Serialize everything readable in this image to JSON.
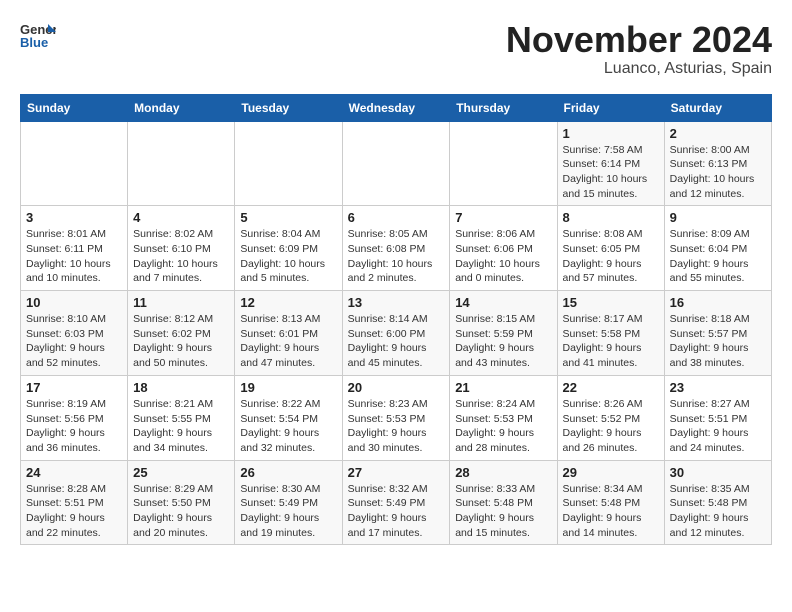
{
  "header": {
    "logo_line1": "General",
    "logo_line2": "Blue",
    "month": "November 2024",
    "location": "Luanco, Asturias, Spain"
  },
  "days_of_week": [
    "Sunday",
    "Monday",
    "Tuesday",
    "Wednesday",
    "Thursday",
    "Friday",
    "Saturday"
  ],
  "weeks": [
    [
      {
        "day": "",
        "info": ""
      },
      {
        "day": "",
        "info": ""
      },
      {
        "day": "",
        "info": ""
      },
      {
        "day": "",
        "info": ""
      },
      {
        "day": "",
        "info": ""
      },
      {
        "day": "1",
        "info": "Sunrise: 7:58 AM\nSunset: 6:14 PM\nDaylight: 10 hours and 15 minutes."
      },
      {
        "day": "2",
        "info": "Sunrise: 8:00 AM\nSunset: 6:13 PM\nDaylight: 10 hours and 12 minutes."
      }
    ],
    [
      {
        "day": "3",
        "info": "Sunrise: 8:01 AM\nSunset: 6:11 PM\nDaylight: 10 hours and 10 minutes."
      },
      {
        "day": "4",
        "info": "Sunrise: 8:02 AM\nSunset: 6:10 PM\nDaylight: 10 hours and 7 minutes."
      },
      {
        "day": "5",
        "info": "Sunrise: 8:04 AM\nSunset: 6:09 PM\nDaylight: 10 hours and 5 minutes."
      },
      {
        "day": "6",
        "info": "Sunrise: 8:05 AM\nSunset: 6:08 PM\nDaylight: 10 hours and 2 minutes."
      },
      {
        "day": "7",
        "info": "Sunrise: 8:06 AM\nSunset: 6:06 PM\nDaylight: 10 hours and 0 minutes."
      },
      {
        "day": "8",
        "info": "Sunrise: 8:08 AM\nSunset: 6:05 PM\nDaylight: 9 hours and 57 minutes."
      },
      {
        "day": "9",
        "info": "Sunrise: 8:09 AM\nSunset: 6:04 PM\nDaylight: 9 hours and 55 minutes."
      }
    ],
    [
      {
        "day": "10",
        "info": "Sunrise: 8:10 AM\nSunset: 6:03 PM\nDaylight: 9 hours and 52 minutes."
      },
      {
        "day": "11",
        "info": "Sunrise: 8:12 AM\nSunset: 6:02 PM\nDaylight: 9 hours and 50 minutes."
      },
      {
        "day": "12",
        "info": "Sunrise: 8:13 AM\nSunset: 6:01 PM\nDaylight: 9 hours and 47 minutes."
      },
      {
        "day": "13",
        "info": "Sunrise: 8:14 AM\nSunset: 6:00 PM\nDaylight: 9 hours and 45 minutes."
      },
      {
        "day": "14",
        "info": "Sunrise: 8:15 AM\nSunset: 5:59 PM\nDaylight: 9 hours and 43 minutes."
      },
      {
        "day": "15",
        "info": "Sunrise: 8:17 AM\nSunset: 5:58 PM\nDaylight: 9 hours and 41 minutes."
      },
      {
        "day": "16",
        "info": "Sunrise: 8:18 AM\nSunset: 5:57 PM\nDaylight: 9 hours and 38 minutes."
      }
    ],
    [
      {
        "day": "17",
        "info": "Sunrise: 8:19 AM\nSunset: 5:56 PM\nDaylight: 9 hours and 36 minutes."
      },
      {
        "day": "18",
        "info": "Sunrise: 8:21 AM\nSunset: 5:55 PM\nDaylight: 9 hours and 34 minutes."
      },
      {
        "day": "19",
        "info": "Sunrise: 8:22 AM\nSunset: 5:54 PM\nDaylight: 9 hours and 32 minutes."
      },
      {
        "day": "20",
        "info": "Sunrise: 8:23 AM\nSunset: 5:53 PM\nDaylight: 9 hours and 30 minutes."
      },
      {
        "day": "21",
        "info": "Sunrise: 8:24 AM\nSunset: 5:53 PM\nDaylight: 9 hours and 28 minutes."
      },
      {
        "day": "22",
        "info": "Sunrise: 8:26 AM\nSunset: 5:52 PM\nDaylight: 9 hours and 26 minutes."
      },
      {
        "day": "23",
        "info": "Sunrise: 8:27 AM\nSunset: 5:51 PM\nDaylight: 9 hours and 24 minutes."
      }
    ],
    [
      {
        "day": "24",
        "info": "Sunrise: 8:28 AM\nSunset: 5:51 PM\nDaylight: 9 hours and 22 minutes."
      },
      {
        "day": "25",
        "info": "Sunrise: 8:29 AM\nSunset: 5:50 PM\nDaylight: 9 hours and 20 minutes."
      },
      {
        "day": "26",
        "info": "Sunrise: 8:30 AM\nSunset: 5:49 PM\nDaylight: 9 hours and 19 minutes."
      },
      {
        "day": "27",
        "info": "Sunrise: 8:32 AM\nSunset: 5:49 PM\nDaylight: 9 hours and 17 minutes."
      },
      {
        "day": "28",
        "info": "Sunrise: 8:33 AM\nSunset: 5:48 PM\nDaylight: 9 hours and 15 minutes."
      },
      {
        "day": "29",
        "info": "Sunrise: 8:34 AM\nSunset: 5:48 PM\nDaylight: 9 hours and 14 minutes."
      },
      {
        "day": "30",
        "info": "Sunrise: 8:35 AM\nSunset: 5:48 PM\nDaylight: 9 hours and 12 minutes."
      }
    ]
  ]
}
